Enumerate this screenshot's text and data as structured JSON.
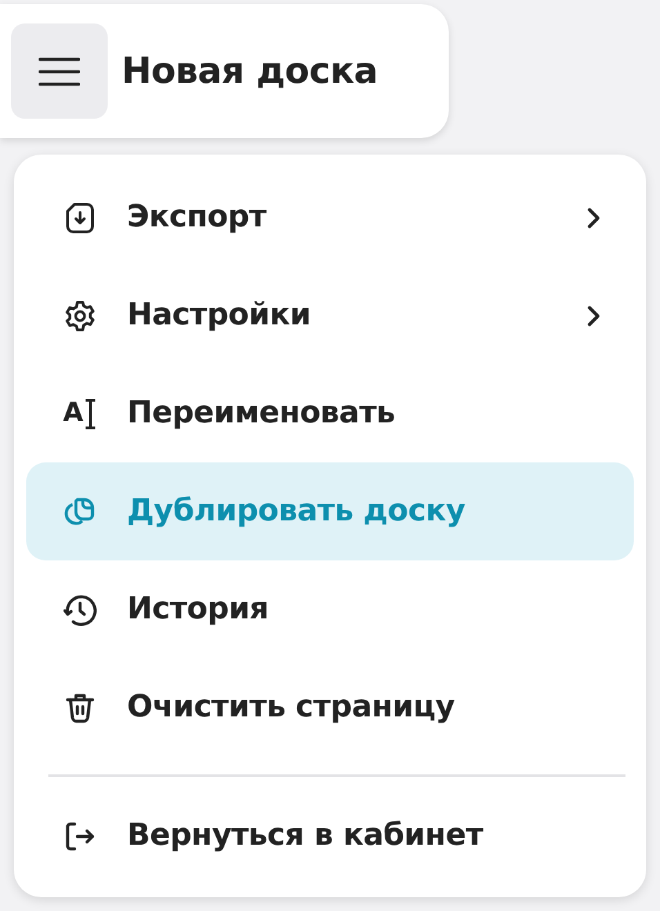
{
  "header": {
    "title": "Новая доска"
  },
  "menu": {
    "items": [
      {
        "kind": "export",
        "label": "Экспорт",
        "submenu": true,
        "selected": false
      },
      {
        "kind": "settings",
        "label": "Настройки",
        "submenu": true,
        "selected": false
      },
      {
        "kind": "rename",
        "label": "Переименовать",
        "icon_glyph": "A",
        "submenu": false,
        "selected": false
      },
      {
        "kind": "duplicate",
        "label": "Дублировать доску",
        "submenu": false,
        "selected": true
      },
      {
        "kind": "history",
        "label": "История",
        "submenu": false,
        "selected": false
      },
      {
        "kind": "clear",
        "label": "Очистить страницу",
        "submenu": false,
        "selected": false
      },
      {
        "kind": "divider"
      },
      {
        "kind": "exit",
        "label": "Вернуться в кабинет",
        "submenu": false,
        "selected": false
      }
    ]
  }
}
